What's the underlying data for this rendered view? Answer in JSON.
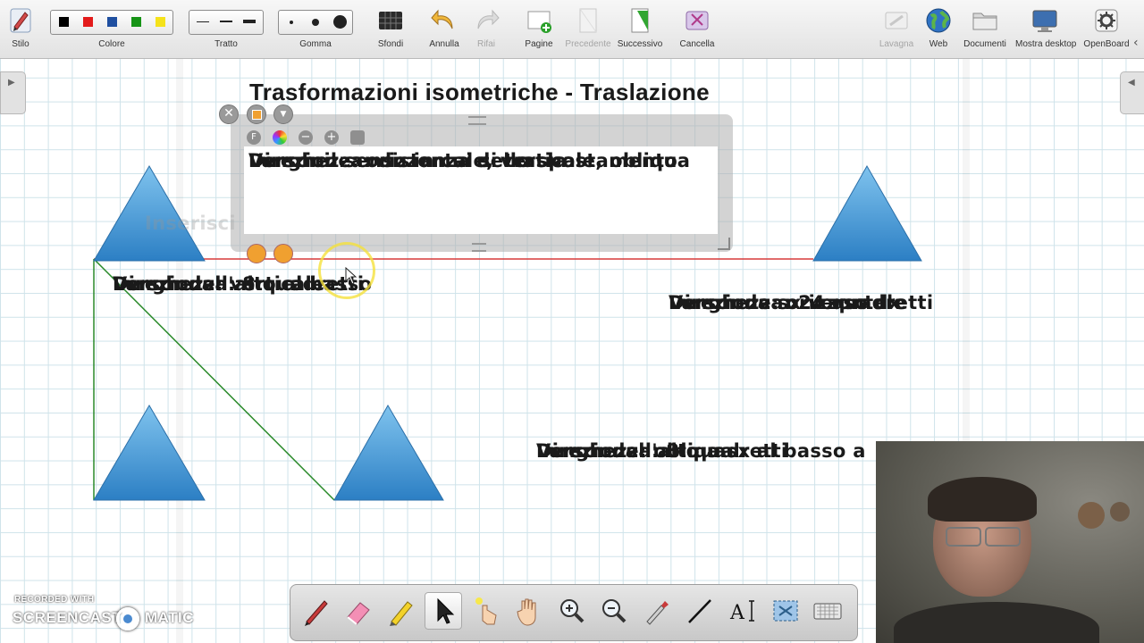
{
  "toolbar": {
    "stilo": "Stilo",
    "colore": "Colore",
    "tratto": "Tratto",
    "gomma": "Gomma",
    "sfondi": "Sfondi",
    "annulla": "Annulla",
    "rifai": "Rifai",
    "pagine": "Pagine",
    "precedente": "Precedente",
    "successivo": "Successivo",
    "cancella": "Cancella",
    "lavagna": "Lavagna",
    "web": "Web",
    "documenti": "Documenti",
    "mostra_desktop": "Mostra desktop",
    "openboard": "OpenBoard",
    "colors": [
      "#000000",
      "#e31b1b",
      "#1f4fa0",
      "#179417",
      "#f5e21a"
    ]
  },
  "board": {
    "title": "Trasformazioni isometriche - Traslazione",
    "placeholder": "Inserisci il testo",
    "textbox_lines": [
      "Direzione: orizzontale, verticale, obliqua",
      "Lunghezza: distanza dello spostamento",
      "Verso: il senso in cui si trasla"
    ],
    "vertical_block": [
      "Direzione: verticale",
      "Lunghezza: 8 quadretti",
      "Verso: dall'alto al basso"
    ],
    "horizontal_block": [
      "Direzione: orizzontale",
      "Lunghezza: 24 quadretti",
      "Verso: da sx verso dx"
    ],
    "oblique_block": [
      "Direzione: obliqua",
      "Lunghezza: 8 quadretti",
      "Verso: dall'alto a sx al basso a"
    ]
  },
  "watermark": {
    "recorded_with": "RECORDED WITH",
    "brand_left": "SCREENCAST",
    "brand_right": "MATIC"
  },
  "colors": {
    "triangle_top": "#7fc3ee",
    "triangle_bottom": "#2c7fc4",
    "red_line": "#d73a3a",
    "green_line": "#2a8a2a"
  },
  "bottom_tools": [
    "pen-tool",
    "eraser-tool",
    "marker-tool",
    "pointer-tool",
    "laser-pointer-tool",
    "hand-tool",
    "zoom-in-tool",
    "zoom-out-tool",
    "pipette-tool",
    "line-tool",
    "text-tool",
    "capture-tool",
    "keyboard-tool"
  ]
}
